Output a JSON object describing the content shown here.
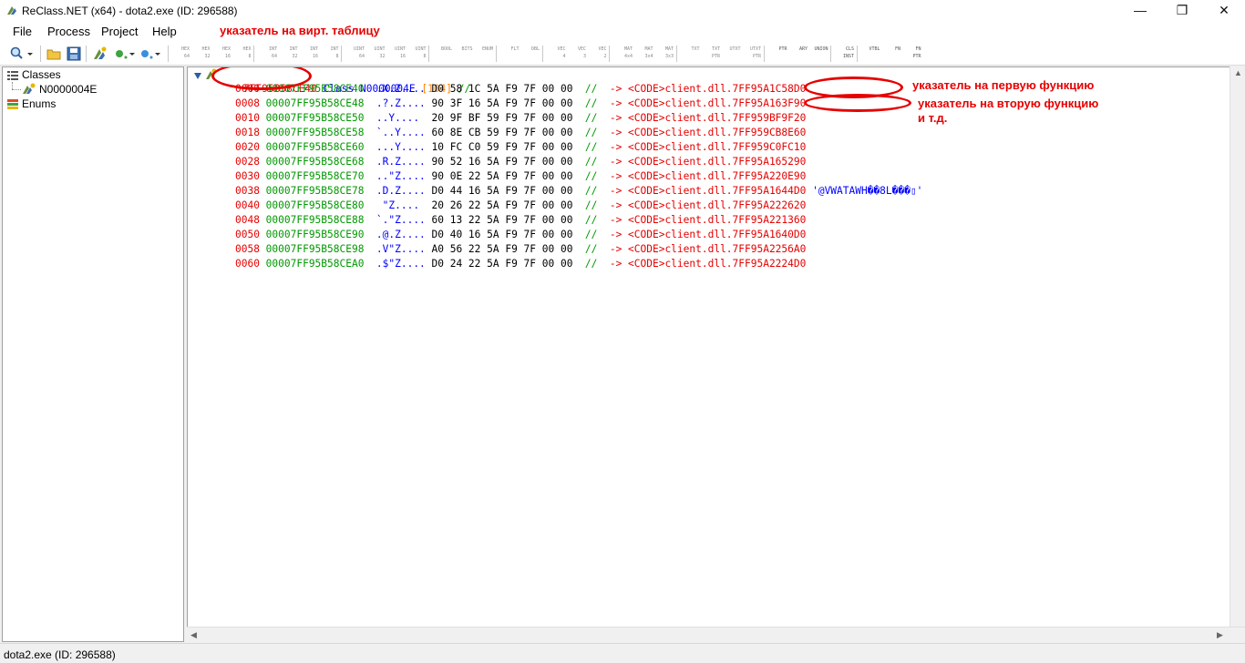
{
  "window": {
    "title": "ReClass.NET (x64) - dota2.exe (ID: 296588)",
    "min_glyph": "—",
    "max_glyph": "❐",
    "close_glyph": "✕"
  },
  "annotations": {
    "vtable": "указатель на вирт. таблицу",
    "first_function": "указатель на первую функцию",
    "second_function": "указатель на вторую функцию",
    "etc": "и т.д."
  },
  "menu": {
    "file": "File",
    "process": "Process",
    "project": "Project",
    "help": "Help"
  },
  "toolbar": {
    "icons": [
      "search-icon",
      "open-folder-icon",
      "save-icon",
      "class-add-icon",
      "bullet-green-icon",
      "bullet-blue-icon"
    ],
    "buttons": [
      {
        "l1": "HEX",
        "l2": "64"
      },
      {
        "l1": "HEX",
        "l2": "32"
      },
      {
        "l1": "HEX",
        "l2": "16"
      },
      {
        "l1": "HEX",
        "l2": "8"
      },
      {
        "l1": "INT",
        "l2": "64"
      },
      {
        "l1": "INT",
        "l2": "32"
      },
      {
        "l1": "INT",
        "l2": "16"
      },
      {
        "l1": "INT",
        "l2": "8"
      },
      {
        "l1": "UINT",
        "l2": "64"
      },
      {
        "l1": "UINT",
        "l2": "32"
      },
      {
        "l1": "UINT",
        "l2": "16"
      },
      {
        "l1": "UINT",
        "l2": "8"
      },
      {
        "l1": "BOOL",
        "l2": ""
      },
      {
        "l1": "BITS",
        "l2": ""
      },
      {
        "l1": "ENUM",
        "l2": ""
      },
      {
        "l1": "FLT",
        "l2": ""
      },
      {
        "l1": "DBL",
        "l2": ""
      },
      {
        "l1": "VEC",
        "l2": "4"
      },
      {
        "l1": "VEC",
        "l2": "3"
      },
      {
        "l1": "VEC",
        "l2": "2"
      },
      {
        "l1": "MAT",
        "l2": "4x4"
      },
      {
        "l1": "MAT",
        "l2": "3x4"
      },
      {
        "l1": "MAT",
        "l2": "3x3"
      },
      {
        "l1": "TXT",
        "l2": ""
      },
      {
        "l1": "TXT",
        "l2": "PTR"
      },
      {
        "l1": "UTXT",
        "l2": ""
      },
      {
        "l1": "UTXT",
        "l2": "PTR"
      },
      {
        "l1": "PTR",
        "l2": ""
      },
      {
        "l1": "ARY",
        "l2": ""
      },
      {
        "l1": "UNION",
        "l2": ""
      },
      {
        "l1": "CLS",
        "l2": "INST"
      },
      {
        "l1": "VTBL",
        "l2": ""
      },
      {
        "l1": "FN",
        "l2": ""
      },
      {
        "l1": "FN",
        "l2": "PTR"
      }
    ]
  },
  "sidebar": {
    "classes_label": "Classes",
    "class_item": "N0000004E",
    "enums_label": "Enums"
  },
  "editor": {
    "header": {
      "address": "7FF95B58CE40",
      "keyword": "Class",
      "name": "N0000004E",
      "size": "[104]",
      "comment": "//"
    },
    "rows": [
      {
        "off": "0000",
        "addr": "00007FF95B58CE40",
        "ascii": ".X.Z....",
        "hex": "D0 58 1C 5A F9 7F 00 00",
        "target": "<CODE>client.dll.7FF95A1C58D0",
        "extra": ""
      },
      {
        "off": "0008",
        "addr": "00007FF95B58CE48",
        "ascii": ".?.Z....",
        "hex": "90 3F 16 5A F9 7F 00 00",
        "target": "<CODE>client.dll.7FF95A163F90",
        "extra": ""
      },
      {
        "off": "0010",
        "addr": "00007FF95B58CE50",
        "ascii": "..Y....",
        "hex": "20 9F BF 59 F9 7F 00 00",
        "target": "<CODE>client.dll.7FF959BF9F20",
        "extra": ""
      },
      {
        "off": "0018",
        "addr": "00007FF95B58CE58",
        "ascii": "`..Y....",
        "hex": "60 8E CB 59 F9 7F 00 00",
        "target": "<CODE>client.dll.7FF959CB8E60",
        "extra": ""
      },
      {
        "off": "0020",
        "addr": "00007FF95B58CE60",
        "ascii": "...Y....",
        "hex": "10 FC C0 59 F9 7F 00 00",
        "target": "<CODE>client.dll.7FF959C0FC10",
        "extra": ""
      },
      {
        "off": "0028",
        "addr": "00007FF95B58CE68",
        "ascii": ".R.Z....",
        "hex": "90 52 16 5A F9 7F 00 00",
        "target": "<CODE>client.dll.7FF95A165290",
        "extra": ""
      },
      {
        "off": "0030",
        "addr": "00007FF95B58CE70",
        "ascii": "..\"Z....",
        "hex": "90 0E 22 5A F9 7F 00 00",
        "target": "<CODE>client.dll.7FF95A220E90",
        "extra": ""
      },
      {
        "off": "0038",
        "addr": "00007FF95B58CE78",
        "ascii": ".D.Z....",
        "hex": "D0 44 16 5A F9 7F 00 00",
        "target": "<CODE>client.dll.7FF95A1644D0",
        "extra": "'@VWATAWH��8L���▯'"
      },
      {
        "off": "0040",
        "addr": "00007FF95B58CE80",
        "ascii": " \"Z....",
        "hex": "20 26 22 5A F9 7F 00 00",
        "target": "<CODE>client.dll.7FF95A222620",
        "extra": ""
      },
      {
        "off": "0048",
        "addr": "00007FF95B58CE88",
        "ascii": "`.\"Z....",
        "hex": "60 13 22 5A F9 7F 00 00",
        "target": "<CODE>client.dll.7FF95A221360",
        "extra": ""
      },
      {
        "off": "0050",
        "addr": "00007FF95B58CE90",
        "ascii": ".@.Z....",
        "hex": "D0 40 16 5A F9 7F 00 00",
        "target": "<CODE>client.dll.7FF95A1640D0",
        "extra": ""
      },
      {
        "off": "0058",
        "addr": "00007FF95B58CE98",
        "ascii": ".V\"Z....",
        "hex": "A0 56 22 5A F9 7F 00 00",
        "target": "<CODE>client.dll.7FF95A2256A0",
        "extra": ""
      },
      {
        "off": "0060",
        "addr": "00007FF95B58CEA0",
        "ascii": ".$\"Z....",
        "hex": "D0 24 22 5A F9 7F 00 00",
        "target": "<CODE>client.dll.7FF95A2224D0",
        "extra": ""
      }
    ],
    "comment_marker": "//",
    "arrow": "->"
  },
  "status": {
    "text": "dota2.exe (ID: 296588)"
  },
  "colors": {
    "offset": "#e60000",
    "address": "#009900",
    "ascii": "#0000ff",
    "annotation": "#e60000"
  }
}
